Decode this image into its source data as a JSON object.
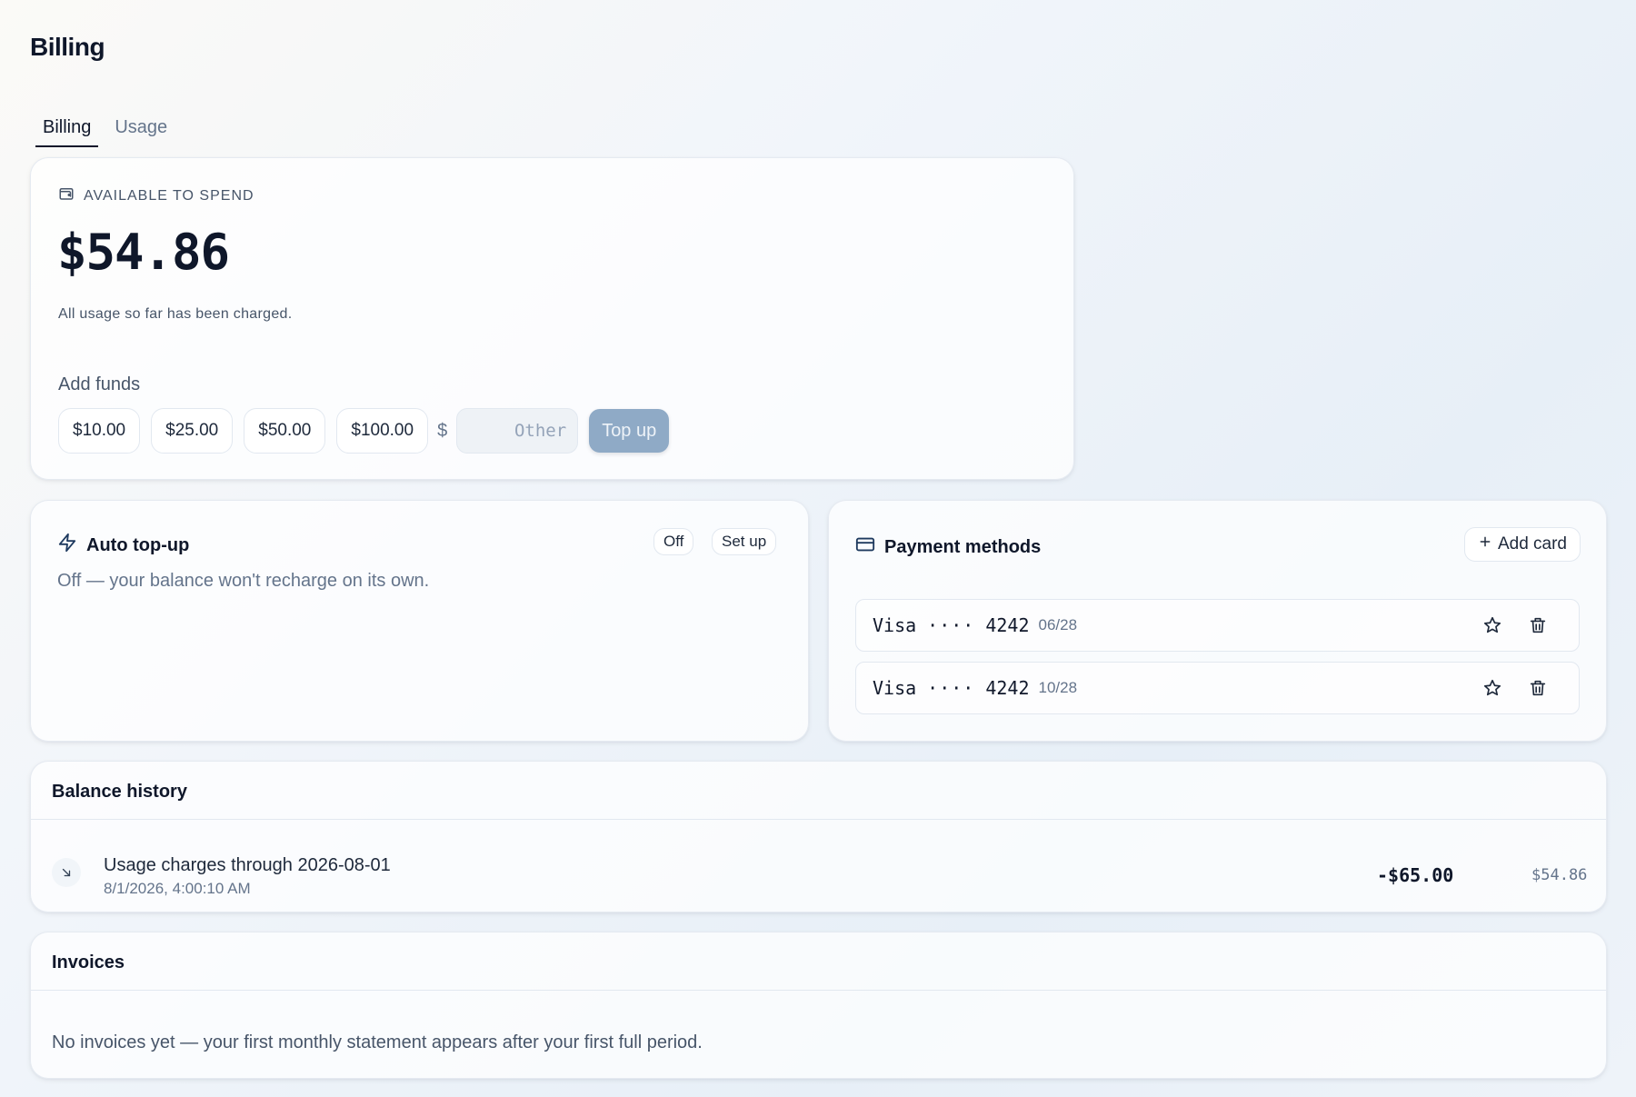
{
  "page": {
    "title": "Billing"
  },
  "tabs": [
    {
      "label": "Billing",
      "active": true
    },
    {
      "label": "Usage",
      "active": false
    }
  ],
  "available": {
    "label": "AVAILABLE TO SPEND",
    "amount": "$54.86",
    "note": "All usage so far has been charged.",
    "add_funds_label": "Add funds",
    "presets": [
      "$10.00",
      "$25.00",
      "$50.00",
      "$100.00"
    ],
    "currency_symbol": "$",
    "other_placeholder": "Other",
    "topup_label": "Top up",
    "icon": "wallet-icon"
  },
  "auto_topup": {
    "title": "Auto top-up",
    "description": "Off — your balance won't recharge on its own.",
    "status_label": "Off",
    "setup_label": "Set up",
    "icon": "lightning-icon"
  },
  "payment_methods": {
    "title": "Payment methods",
    "add_card_label": "Add card",
    "icon": "credit-card-icon",
    "cards": [
      {
        "brand": "Visa",
        "dots": "····",
        "last4": "4242",
        "exp": "06/28"
      },
      {
        "brand": "Visa",
        "dots": "····",
        "last4": "4242",
        "exp": "10/28"
      }
    ]
  },
  "balance_history": {
    "title": "Balance history",
    "entries": [
      {
        "title": "Usage charges through 2026-08-01",
        "time": "8/1/2026, 4:00:10 AM",
        "amount": "-$65.00",
        "balance": "$54.86",
        "icon": "arrow-down-right-icon"
      }
    ]
  },
  "invoices": {
    "title": "Invoices",
    "empty_text": "No invoices yet — your first monthly statement appears after your first full period."
  },
  "colors": {
    "accent_disabled": "#8faac6",
    "text_primary": "#0f172a",
    "text_muted": "#64748b"
  }
}
